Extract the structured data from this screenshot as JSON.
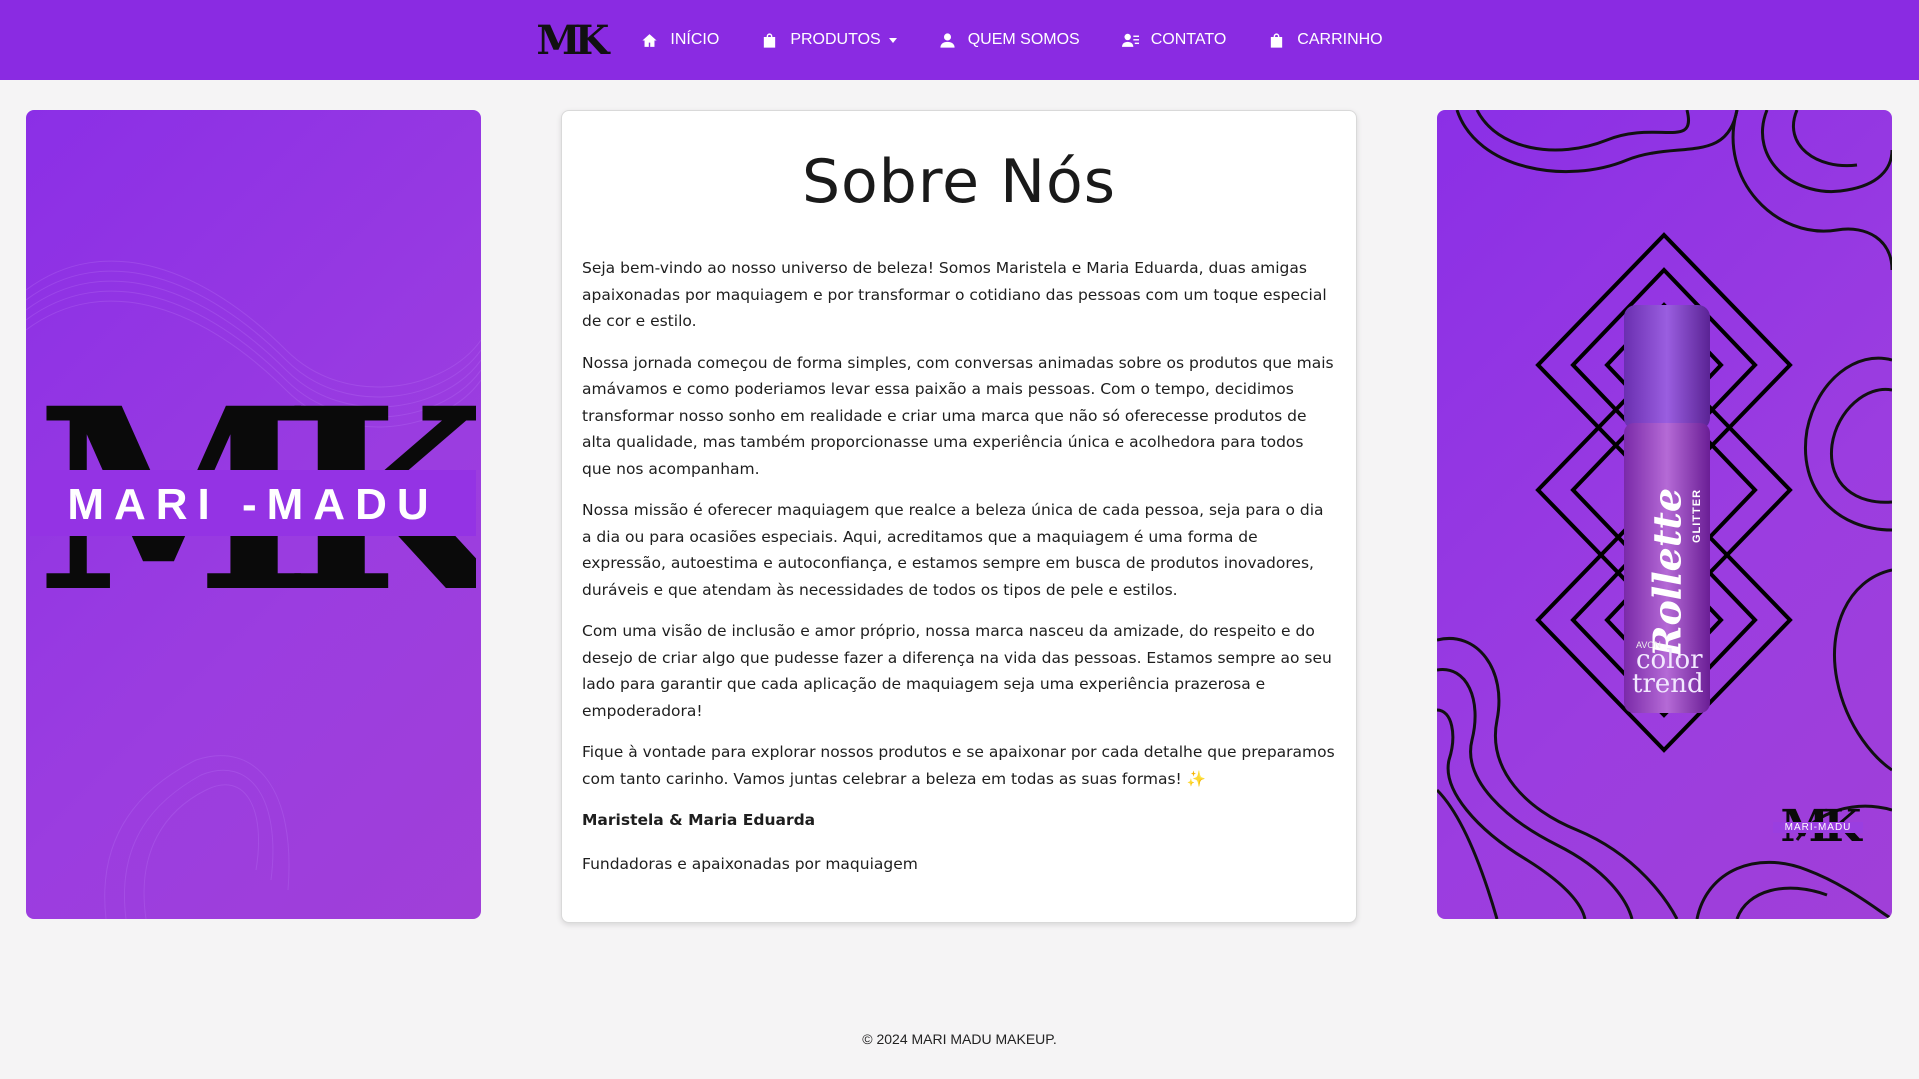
{
  "nav": {
    "brand": "MK",
    "items": [
      {
        "label": "INÍCIO",
        "icon": "home-icon"
      },
      {
        "label": "PRODUTOS",
        "icon": "bag-icon",
        "dropdown": true
      },
      {
        "label": "QUEM SOMOS",
        "icon": "user-icon"
      },
      {
        "label": "CONTATO",
        "icon": "contact-icon"
      },
      {
        "label": "CARRINHO",
        "icon": "cart-bag-icon"
      }
    ]
  },
  "left_banner": {
    "letters": "MK",
    "name": "MARI -MADU"
  },
  "main": {
    "title": "Sobre Nós",
    "paragraphs": [
      "Seja bem-vindo ao nosso universo de beleza! Somos Maristela e Maria Eduarda, duas amigas apaixonadas por maquiagem e por transformar o cotidiano das pessoas com um toque especial de cor e estilo.",
      "Nossa jornada começou de forma simples, com conversas animadas sobre os produtos que mais amávamos e como poderiamos levar essa paixão a mais pessoas. Com o tempo, decidimos transformar nosso sonho em realidade e criar uma marca que não só oferecesse produtos de alta qualidade, mas também proporcionasse uma experiência única e acolhedora para todos que nos acompanham.",
      "Nossa missão é oferecer maquiagem que realce a beleza única de cada pessoa, seja para o dia a dia ou para ocasiões especiais. Aqui, acreditamos que a maquiagem é uma forma de expressão, autoestima e autoconfiança, e estamos sempre em busca de produtos inovadores, duráveis e que atendam às necessidades de todos os tipos de pele e estilos.",
      "Com uma visão de inclusão e amor próprio, nossa marca nasceu da amizade, do respeito e do desejo de criar algo que pudesse fazer a diferença na vida das pessoas. Estamos sempre ao seu lado para garantir que cada aplicação de maquiagem seja uma experiência prazerosa e empoderadora!",
      "Fique à vontade para explorar nossos produtos e se apaixonar por cada detalhe que preparamos com tanto carinho. Vamos juntas celebrar a beleza em todas as suas formas! ✨"
    ],
    "signature": "Maristela & Maria Eduarda",
    "role": "Fundadoras e apaixonadas por maquiagem"
  },
  "right_banner": {
    "product_name": "Rollette",
    "product_sub": "GLITTER",
    "brand_small": "AVON",
    "brand_line1": "color",
    "brand_line2": "trend",
    "logo_letters": "MK",
    "logo_name": "MARI-MADU"
  },
  "footer": {
    "text": "© 2024 MARI MADU MAKEUP."
  },
  "colors": {
    "primary": "#8a2be2",
    "background": "#f5f4f5"
  }
}
